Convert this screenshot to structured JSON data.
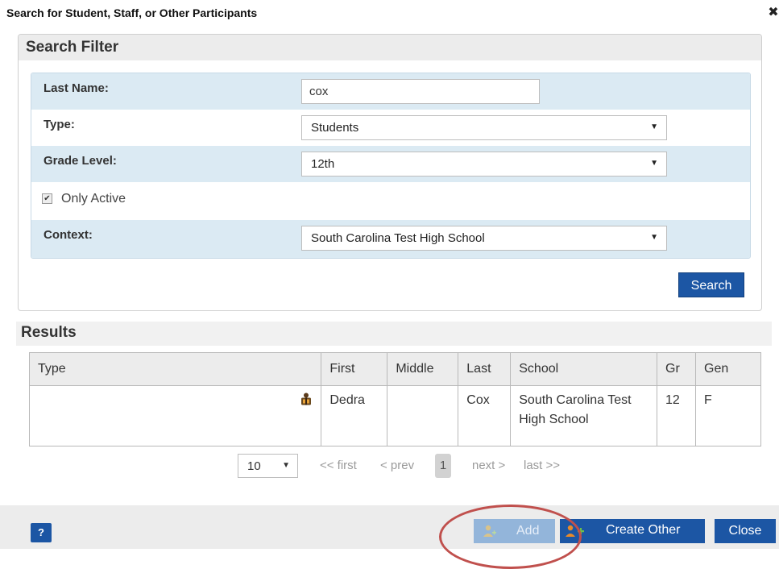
{
  "dialog": {
    "title": "Search for Student, Staff, or Other Participants",
    "close_glyph": "✖"
  },
  "filter": {
    "header": "Search Filter",
    "last_name": {
      "label": "Last Name:",
      "value": "cox"
    },
    "type": {
      "label": "Type:",
      "selected": "Students"
    },
    "grade_level": {
      "label": "Grade Level:",
      "selected": "12th"
    },
    "only_active": {
      "label": "Only Active",
      "checked": true,
      "glyph": "✔"
    },
    "context": {
      "label": "Context:",
      "selected": "South Carolina Test High School"
    },
    "select_arrow": "▼",
    "search_label": "Search"
  },
  "results": {
    "header": "Results",
    "columns": [
      "Type",
      "First",
      "Middle",
      "Last",
      "School",
      "Gr",
      "Gen"
    ],
    "rows": [
      {
        "type_icon": "student-icon",
        "first": "Dedra",
        "middle": "",
        "last": "Cox",
        "school": "South Carolina Test High School",
        "gr": "12",
        "gen": "F"
      }
    ]
  },
  "pagination": {
    "page_size": "10",
    "first": "<< first",
    "prev": "< prev",
    "current": "1",
    "next": "next >",
    "last": "last >>"
  },
  "footer": {
    "help_label": "?",
    "add_label": "Add",
    "create_other_label": "Create Other",
    "close_label": "Close"
  },
  "colors": {
    "primary_button": "#1c56a4",
    "row_shade": "#dbeaf3",
    "annotation": "#c0504d"
  }
}
